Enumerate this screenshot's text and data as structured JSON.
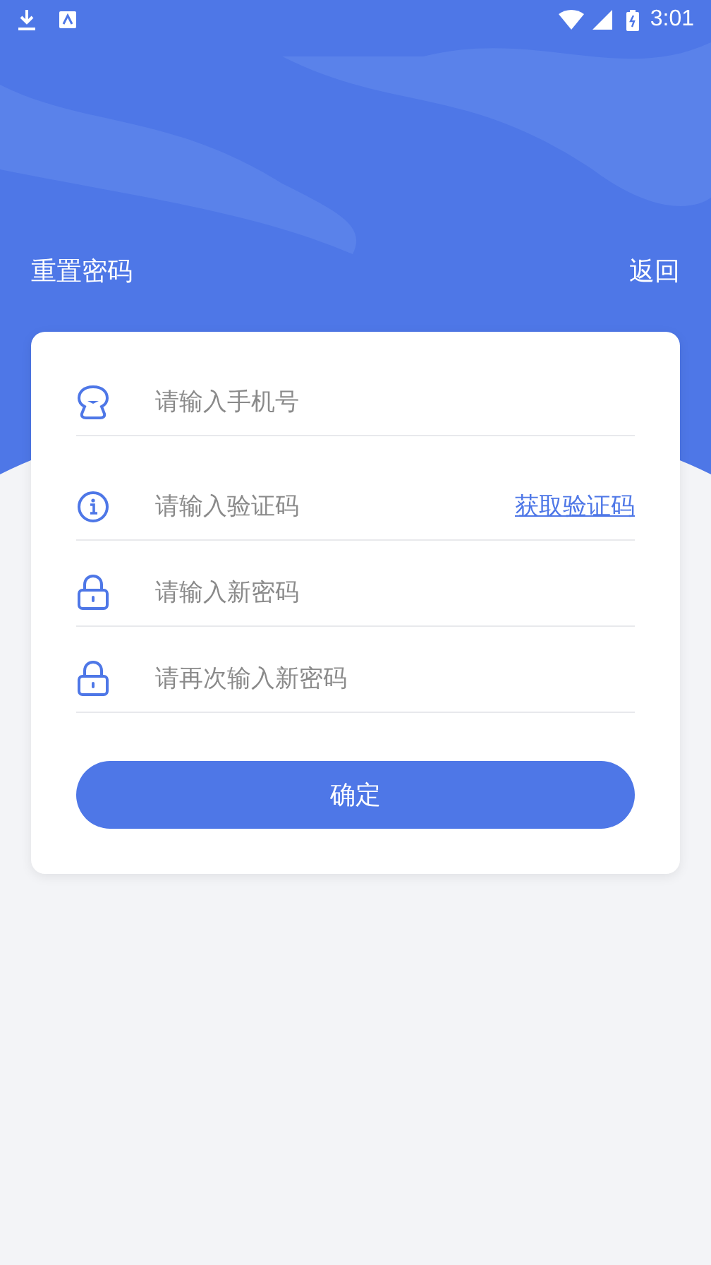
{
  "status_bar": {
    "time": "3:01"
  },
  "header": {
    "title": "重置密码",
    "back": "返回"
  },
  "fields": [
    {
      "kind": "phone",
      "placeholder": "请输入手机号"
    },
    {
      "kind": "code",
      "placeholder": "请输入验证码",
      "action": "获取验证码"
    },
    {
      "kind": "password",
      "placeholder": "请输入新密码"
    },
    {
      "kind": "password",
      "placeholder": "请再次输入新密码"
    }
  ],
  "submit": "确定"
}
